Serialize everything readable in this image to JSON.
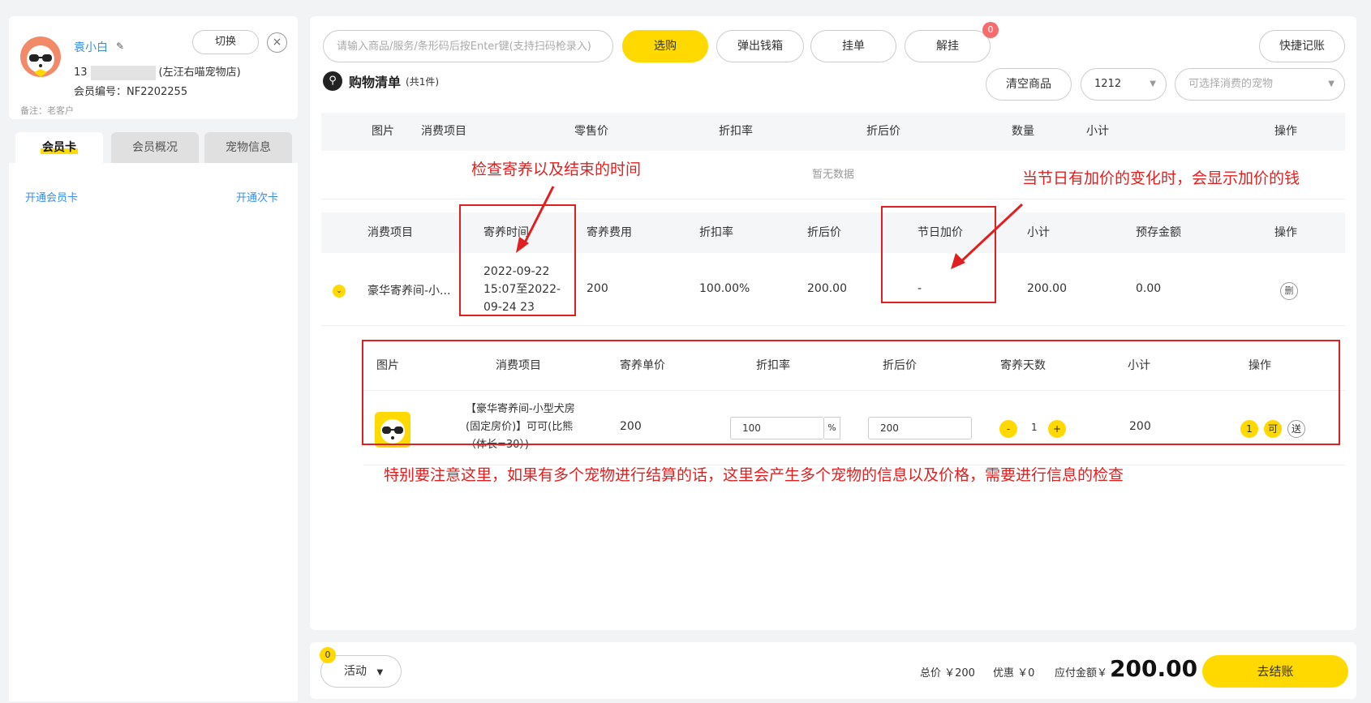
{
  "member": {
    "name": "袁小白",
    "phone_prefix": "13",
    "store": "(左汪右喵宠物店)",
    "member_no": "会员编号：NF2202255",
    "note": "备注：老客户",
    "switch_label": "切换",
    "close_label": "×"
  },
  "left_tabs": [
    "会员卡",
    "会员概况",
    "宠物信息"
  ],
  "left_links": {
    "open_card": "开通会员卡",
    "open_times": "开通次卡"
  },
  "toolbar": {
    "search_placeholder": "请输入商品/服务/条形码后按Enter键(支持扫码枪录入)",
    "select_btn": "选购",
    "cashbox_btn": "弹出钱箱",
    "hold_btn": "挂单",
    "release_btn": "解挂",
    "release_badge": "0",
    "quick_btn": "快捷记账"
  },
  "cart": {
    "title": "购物清单",
    "count": "(共1件)",
    "clear_btn": "清空商品",
    "staff_select": "1212",
    "pet_select_placeholder": "可选择消费的宠物"
  },
  "table1": {
    "headers": [
      "图片",
      "消费项目",
      "零售价",
      "折扣率",
      "折后价",
      "数量",
      "小计",
      "操作"
    ],
    "empty": "暂无数据"
  },
  "table2": {
    "headers": [
      "消费项目",
      "寄养时间",
      "寄养费用",
      "折扣率",
      "折后价",
      "节日加价",
      "小计",
      "预存金额",
      "操作"
    ],
    "row": {
      "item": "豪华寄养间-小...",
      "time": "2022-09-22 15:07至2022-09-24 23",
      "fee": "200",
      "rate": "100.00%",
      "price": "200.00",
      "holiday": "-",
      "subtotal": "200.00",
      "deposit": "0.00",
      "del": "删"
    }
  },
  "table3": {
    "headers": [
      "图片",
      "消费项目",
      "寄养单价",
      "折扣率",
      "折后价",
      "寄养天数",
      "小计",
      "操作"
    ],
    "row": {
      "name": "【豪华寄养间-小型犬房(固定房价)】可可(比熊（体长=30）)",
      "unit_price": "200",
      "rate": "100",
      "pct": "%",
      "price": "200",
      "minus": "-",
      "days": "1",
      "plus": "+",
      "subtotal": "200",
      "op1": "1",
      "op2": "可",
      "op3": "送"
    }
  },
  "annotations": {
    "time_note": "检查寄养以及结束的时间",
    "holiday_note": "当节日有加价的变化时，会显示加价的钱",
    "multi_pet_note": "特别要注意这里，如果有多个宠物进行结算的话，这里会产生多个宠物的信息以及价格，需要进行信息的检查"
  },
  "footer": {
    "activity_btn": "活动",
    "activity_badge": "0",
    "total": "总价 ￥200",
    "discount": "优惠 ￥0",
    "payable_label": "应付金额￥",
    "payable": "200.00",
    "checkout_btn": "去结账"
  },
  "colors": {
    "accent": "#ffd900",
    "link": "#3a8ee6",
    "annotation": "#e02020"
  }
}
